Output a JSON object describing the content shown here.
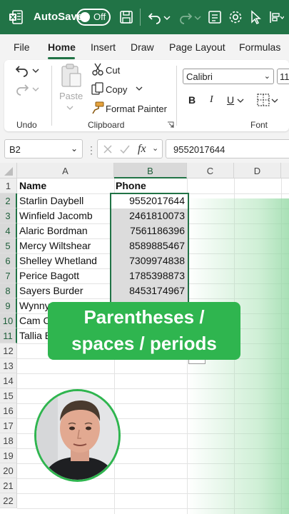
{
  "app": {
    "autosave_label": "AutoSave",
    "autosave_state": "Off"
  },
  "menu": {
    "tabs": [
      "File",
      "Home",
      "Insert",
      "Draw",
      "Page Layout",
      "Formulas"
    ],
    "active_tab": "Home"
  },
  "ribbon": {
    "undo_group_label": "Undo",
    "clipboard": {
      "paste_label": "Paste",
      "cut_label": "Cut",
      "copy_label": "Copy",
      "format_painter_label": "Format Painter",
      "group_label": "Clipboard"
    },
    "font": {
      "font_name": "Calibri",
      "font_size": "11",
      "bold_label": "B",
      "italic_label": "I",
      "underline_label": "U",
      "group_label": "Font"
    }
  },
  "formula_bar": {
    "name_box": "B2",
    "fx_label": "fx",
    "value": "9552017644"
  },
  "grid": {
    "columns": [
      "A",
      "B",
      "C",
      "D"
    ],
    "selected_column": "B",
    "rows": [
      "1",
      "2",
      "3",
      "4",
      "5",
      "6",
      "7",
      "8",
      "9",
      "10",
      "11",
      "12",
      "13",
      "14",
      "15",
      "16",
      "17",
      "18",
      "19",
      "20",
      "21",
      "22"
    ],
    "header": {
      "name": "Name",
      "phone": "Phone"
    },
    "data": [
      {
        "name": "Starlin Daybell",
        "phone": "9552017644"
      },
      {
        "name": "Winfield Jacomb",
        "phone": "2461810073"
      },
      {
        "name": "Alaric Bordman",
        "phone": "7561186396"
      },
      {
        "name": "Mercy Wiltshear",
        "phone": "8589885467"
      },
      {
        "name": "Shelley Whetland",
        "phone": "7309974838"
      },
      {
        "name": "Perice Bagott",
        "phone": "1785398873"
      },
      {
        "name": "Sayers Burder",
        "phone": "8453174967"
      },
      {
        "name": "Wynny",
        "phone": ""
      },
      {
        "name": "Cam Cl",
        "phone": ""
      },
      {
        "name": "Tallia B",
        "phone": ""
      }
    ]
  },
  "overlay": {
    "caption_line1": "Parentheses /",
    "caption_line2": "spaces / periods"
  },
  "colors": {
    "brand": "#217346",
    "caption_bg": "#2fb54f"
  }
}
